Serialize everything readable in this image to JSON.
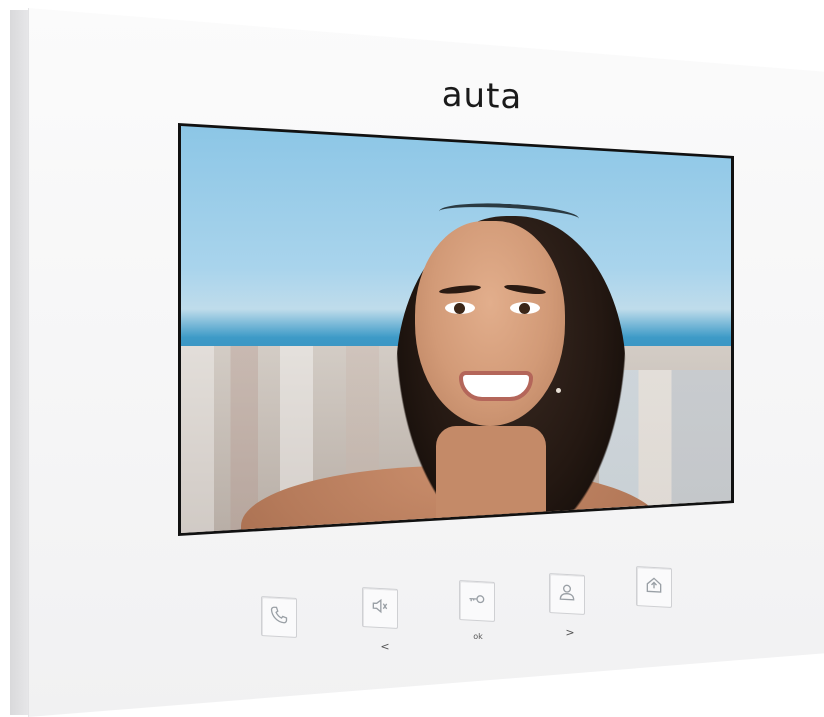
{
  "brand": {
    "name": "auta"
  },
  "screen": {
    "content": "video-feed"
  },
  "buttons": [
    {
      "id": "call",
      "icon": "phone-icon",
      "caption": ""
    },
    {
      "id": "volume",
      "icon": "speaker-icon",
      "caption": "<"
    },
    {
      "id": "unlock",
      "icon": "key-icon",
      "caption": "ok"
    },
    {
      "id": "monitor",
      "icon": "user-icon",
      "caption": ">"
    },
    {
      "id": "menu",
      "icon": "home-icon",
      "caption": ""
    }
  ],
  "colors": {
    "device": "#f7f7f8",
    "brand_text": "#1a1a1a",
    "icon_stroke": "#9aa0a6"
  }
}
